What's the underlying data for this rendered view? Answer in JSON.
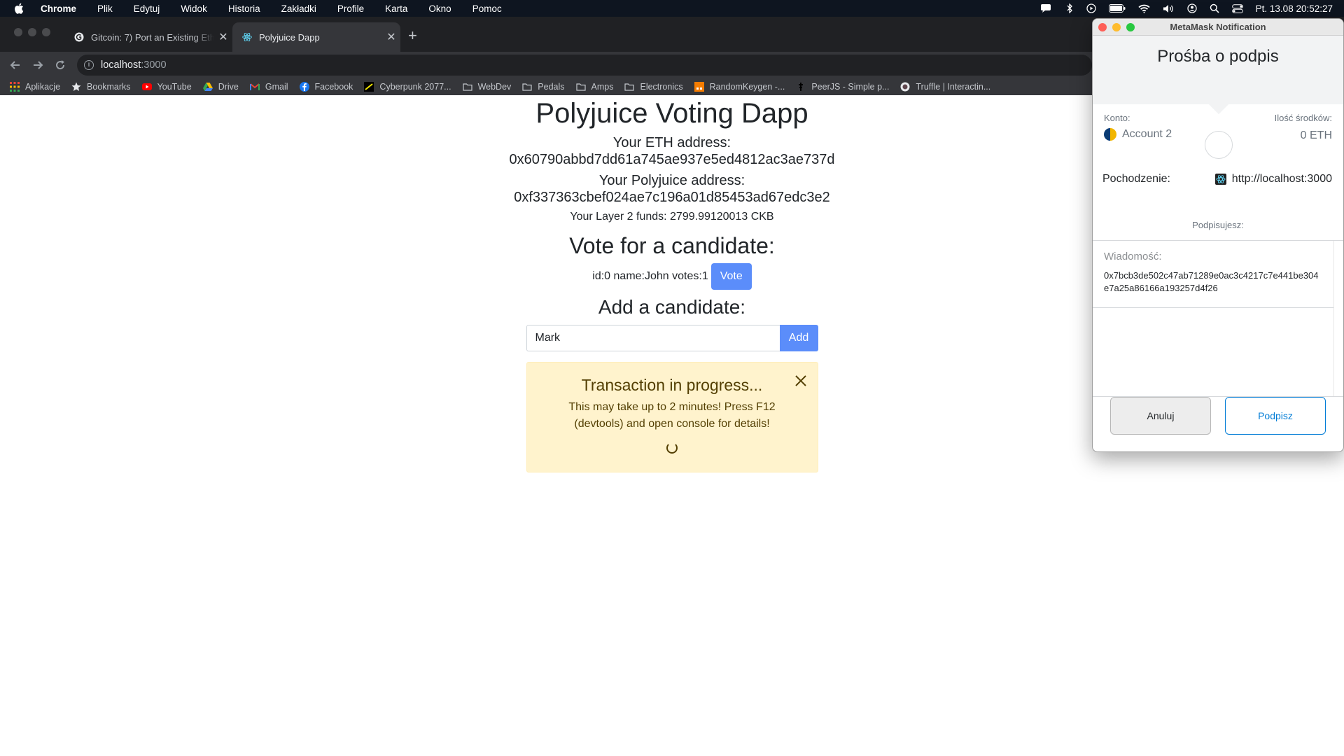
{
  "menubar": {
    "app": "Chrome",
    "items": [
      "Plik",
      "Edytuj",
      "Widok",
      "Historia",
      "Zakładki",
      "Profile",
      "Karta",
      "Okno",
      "Pomoc"
    ],
    "clock": "Pt. 13.08  20:52:27"
  },
  "tabs": [
    {
      "title": "Gitcoin: 7) Port an Existing Eth",
      "close": "✕"
    },
    {
      "title": "Polyjuice Dapp",
      "close": "✕"
    }
  ],
  "newtab": "+",
  "address_bar": {
    "host": "localhost",
    "port": ":3000"
  },
  "bookmarks": [
    "Aplikacje",
    "Bookmarks",
    "YouTube",
    "Drive",
    "Gmail",
    "Facebook",
    "Cyberpunk 2077...",
    "WebDev",
    "Pedals",
    "Amps",
    "Electronics",
    "RandomKeygen -...",
    "PeerJS - Simple p...",
    "Truffle | Interactin..."
  ],
  "app": {
    "title": "Polyjuice Voting Dapp",
    "eth_label": "Your ETH address:",
    "eth_address": "0x60790abbd7dd61a745ae937e5ed4812ac3ae737d",
    "poly_label": "Your Polyjuice address:",
    "poly_address": "0xf337363cbef024ae7c196a01d85453ad67edc3e2",
    "funds": "Your Layer 2 funds: 2799.99120013 CKB",
    "vote_heading": "Vote for a candidate:",
    "candidate": "id:0 name:John votes:1",
    "vote_button": "Vote",
    "add_heading": "Add a candidate:",
    "add_input_value": "Mark",
    "add_button": "Add",
    "alert": {
      "title": "Transaction in progress...",
      "body": "This may take up to 2 minutes! Press F12 (devtools) and open console for details!"
    }
  },
  "metamask": {
    "window_title": "MetaMask Notification",
    "header": "Prośba o podpis",
    "account_label": "Konto:",
    "account_name": "Account 2",
    "balance_label": "Ilość środków:",
    "balance": "0 ETH",
    "origin_label": "Pochodzenie:",
    "origin": "http://localhost:3000",
    "signing_label": "Podpisujesz:",
    "message_label": "Wiadomość:",
    "message": "0x7bcb3de502c47ab71289e0ac3c4217c7e441be304e7a25a86166a193257d4f26",
    "cancel_button": "Anuluj",
    "sign_button": "Podpisz"
  },
  "colors": {
    "accent_button": "#5b8dfa",
    "alert_bg": "#fff3cd",
    "metamask_blue": "#037dd6"
  }
}
